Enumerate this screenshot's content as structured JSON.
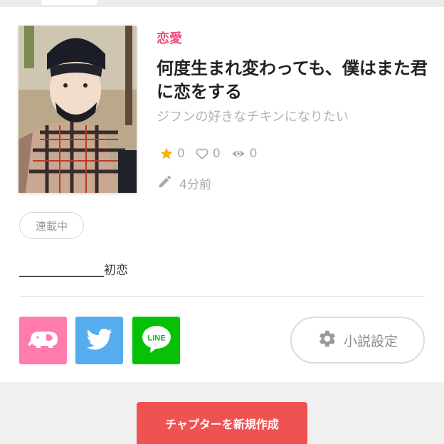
{
  "novel": {
    "genre": "恋愛",
    "title": "何度生まれ変わっても、僕はまた君に恋をする",
    "subtitle": "ジフンの好きなチキンになりたい",
    "status": "連載中",
    "description": "______________初恋"
  },
  "stats": {
    "stars": "0",
    "likes": "0",
    "views": "0",
    "updated": "4分前"
  },
  "share": {
    "line_label": "LINE"
  },
  "actions": {
    "settings_label": "小説設定",
    "new_chapter_label": "チャプターを新規作成"
  },
  "colors": {
    "accent_pink": "#ec4f7a",
    "star": "#f5b400",
    "estar_pink": "#ff7bae",
    "twitter_blue": "#55acee",
    "line_green": "#06c106",
    "new_chapter_red": "#ee5352"
  },
  "icons": [
    "star-icon",
    "heart-icon",
    "eye-icon",
    "pencil-icon",
    "elephant-icon",
    "twitter-bird-icon",
    "line-icon",
    "gear-icon"
  ]
}
